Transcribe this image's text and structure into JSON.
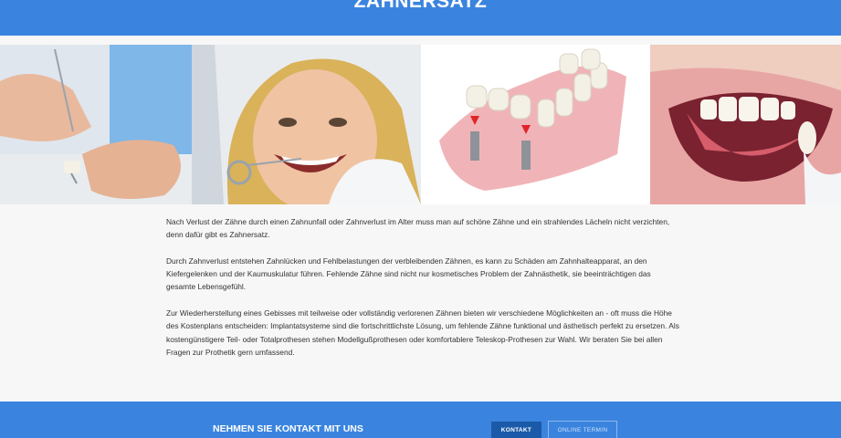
{
  "header": {
    "title": "ZAHNERSATZ"
  },
  "gallery": {
    "images": [
      "dentist-hands-with-crown-image",
      "smiling-patient-dental-exam-image",
      "dental-bridge-implant-illustration",
      "teeth-close-up-with-veneer-image"
    ]
  },
  "content": {
    "paragraphs": [
      "Nach Verlust der Zähne durch einen Zahnunfall oder Zahnverlust im Alter muss man auf schöne Zähne und ein strahlendes Lächeln nicht verzichten, denn dafür gibt es Zahnersatz.",
      "Durch Zahnverlust entstehen Zahnlücken und Fehlbelastungen der verbleibenden Zähnen, es kann zu Schäden am Zahnhalteapparat, an den Kiefergelenken und der Kaumuskulatur führen. Fehlende Zähne sind nicht nur kosmetisches Problem der Zahnästhetik, sie beeinträchtigen das gesamte Lebensgefühl.",
      "Zur Wiederherstellung eines Gebisses mit teilweise oder vollständig verlorenen Zähnen bieten wir verschiedene Möglichkeiten an - oft muss die Höhe des Kostenplans entscheiden: Implantatsysteme sind die fortschrittlichste Lösung, um fehlende Zähne funktional und ästhetisch perfekt zu ersetzen. Als kostengünstigere Teil- oder Totalprothesen stehen Modellgußprothesen oder komfortablere Teleskop-Prothesen zur Wahl. Wir beraten Sie bei allen Fragen zur Prothetik gern umfassend."
    ]
  },
  "contact": {
    "heading": "NEHMEN SIE KONTAKT MIT UNS",
    "kontakt_label": "KONTAKT",
    "termin_label": "ONLINE TERMIN"
  },
  "colors": {
    "accent": "#3a84df",
    "button_dark": "#1a5aa8",
    "background": "#f7f7f7"
  }
}
